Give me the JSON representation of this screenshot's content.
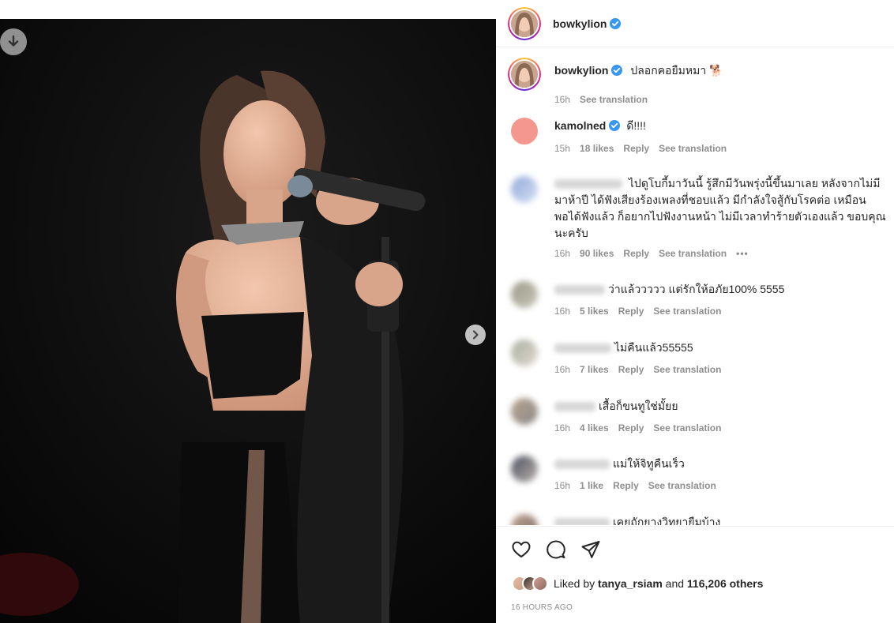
{
  "header": {
    "username": "bowkylion"
  },
  "caption": {
    "username": "bowkylion",
    "text": "ปลอกคอยืมหมา 🐕",
    "time": "16h",
    "see_translation": "See translation"
  },
  "comments": [
    {
      "username": "kamolned",
      "verified": true,
      "text": "ดี!!!!",
      "time": "15h",
      "likes": "18 likes",
      "reply": "Reply",
      "see_translation": "See translation"
    },
    {
      "username": "",
      "blurred": true,
      "text": "ไปดูโบกี้มาวันนี้ รู้สึกมีวันพรุ่งนี้ขึ้นมาเลย หลังจากไม่มีมาห้าปี ได้ฟังเสียงร้องเพลงที่ชอบแล้ว มีกำลังใจสู้กับโรคต่อ เหมือนพอได้ฟังแล้ว ก็อยากไปฟังงานหน้า ไม่มีเวลาทำร้ายตัวเองแล้ว ขอบคุณนะครับ",
      "time": "16h",
      "likes": "90 likes",
      "reply": "Reply",
      "see_translation": "See translation",
      "more": "•••"
    },
    {
      "username": "",
      "blurred": true,
      "text": "ว่าแล้ววววว แต่รักให้อภัย100% 5555",
      "time": "16h",
      "likes": "5 likes",
      "reply": "Reply",
      "see_translation": "See translation"
    },
    {
      "username": "",
      "blurred": true,
      "text": "ไม่คืนแล้ว55555",
      "time": "16h",
      "likes": "7 likes",
      "reply": "Reply",
      "see_translation": "See translation"
    },
    {
      "username": "",
      "blurred": true,
      "text": "เสื้อก็ขนทูใช่มั้ยย",
      "time": "16h",
      "likes": "4 likes",
      "reply": "Reply",
      "see_translation": "See translation"
    },
    {
      "username": "",
      "blurred": true,
      "text": "แม่ให้จิทูคืนเร็ว",
      "time": "16h",
      "likes": "1 like",
      "reply": "Reply",
      "see_translation": "See translation"
    },
    {
      "username": "",
      "blurred": true,
      "text": "เคยถักยางวิทยายืมบ้าง",
      "time": "",
      "likes": "",
      "reply": "",
      "see_translation": ""
    }
  ],
  "likes": {
    "prefix": "Liked by",
    "user": "tanya_rsiam",
    "and": "and",
    "others": "116,206 others"
  },
  "timestamp": "16 HOURS AGO",
  "icons": {
    "download": "download-icon",
    "next": "chevron-right-icon",
    "like": "heart-icon",
    "comment": "comment-icon",
    "share": "share-icon",
    "verified": "verified-badge-icon"
  },
  "colors": {
    "verified": "#3897f0",
    "muted": "#8e8e8e",
    "text": "#262626",
    "kamolned_avatar": "#f4978e"
  }
}
